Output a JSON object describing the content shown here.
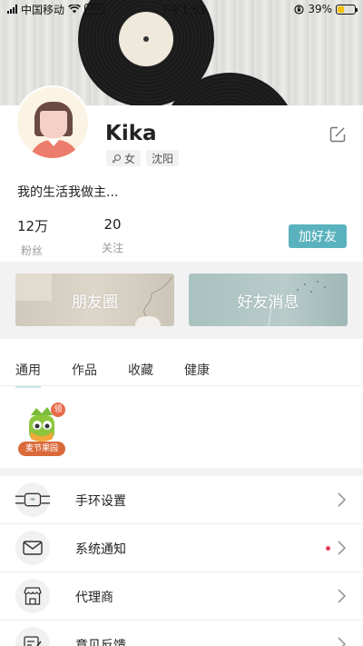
{
  "status_bar": {
    "carrier": "中国移动",
    "vpn": "VPN",
    "time": "下午1:53",
    "battery_percent": "39%",
    "battery_level": 0.39
  },
  "profile": {
    "name": "Kika",
    "gender": "女",
    "city": "沈阳",
    "bio": "我的生活我做主...",
    "stats": [
      {
        "value": "12万",
        "label": "粉丝"
      },
      {
        "value": "20",
        "label": "关注"
      }
    ],
    "add_friend_label": "加好友"
  },
  "banners": {
    "moments": "朋友圈",
    "friend_news": "好友消息"
  },
  "tabs": [
    {
      "label": "通用",
      "active": true
    },
    {
      "label": "作品",
      "active": false
    },
    {
      "label": "收藏",
      "active": false
    },
    {
      "label": "健康",
      "active": false
    }
  ],
  "apps": [
    {
      "label": "麦节果园",
      "badge": "领"
    }
  ],
  "menu": [
    {
      "label": "手环设置",
      "icon": "band-icon",
      "dot": false
    },
    {
      "label": "系统通知",
      "icon": "envelope-icon",
      "dot": true
    },
    {
      "label": "代理商",
      "icon": "store-icon",
      "dot": false
    },
    {
      "label": "意见反馈",
      "icon": "feedback-icon",
      "dot": false
    }
  ],
  "colors": {
    "accent": "#5ab2be",
    "notification_dot": "#e4405f"
  }
}
